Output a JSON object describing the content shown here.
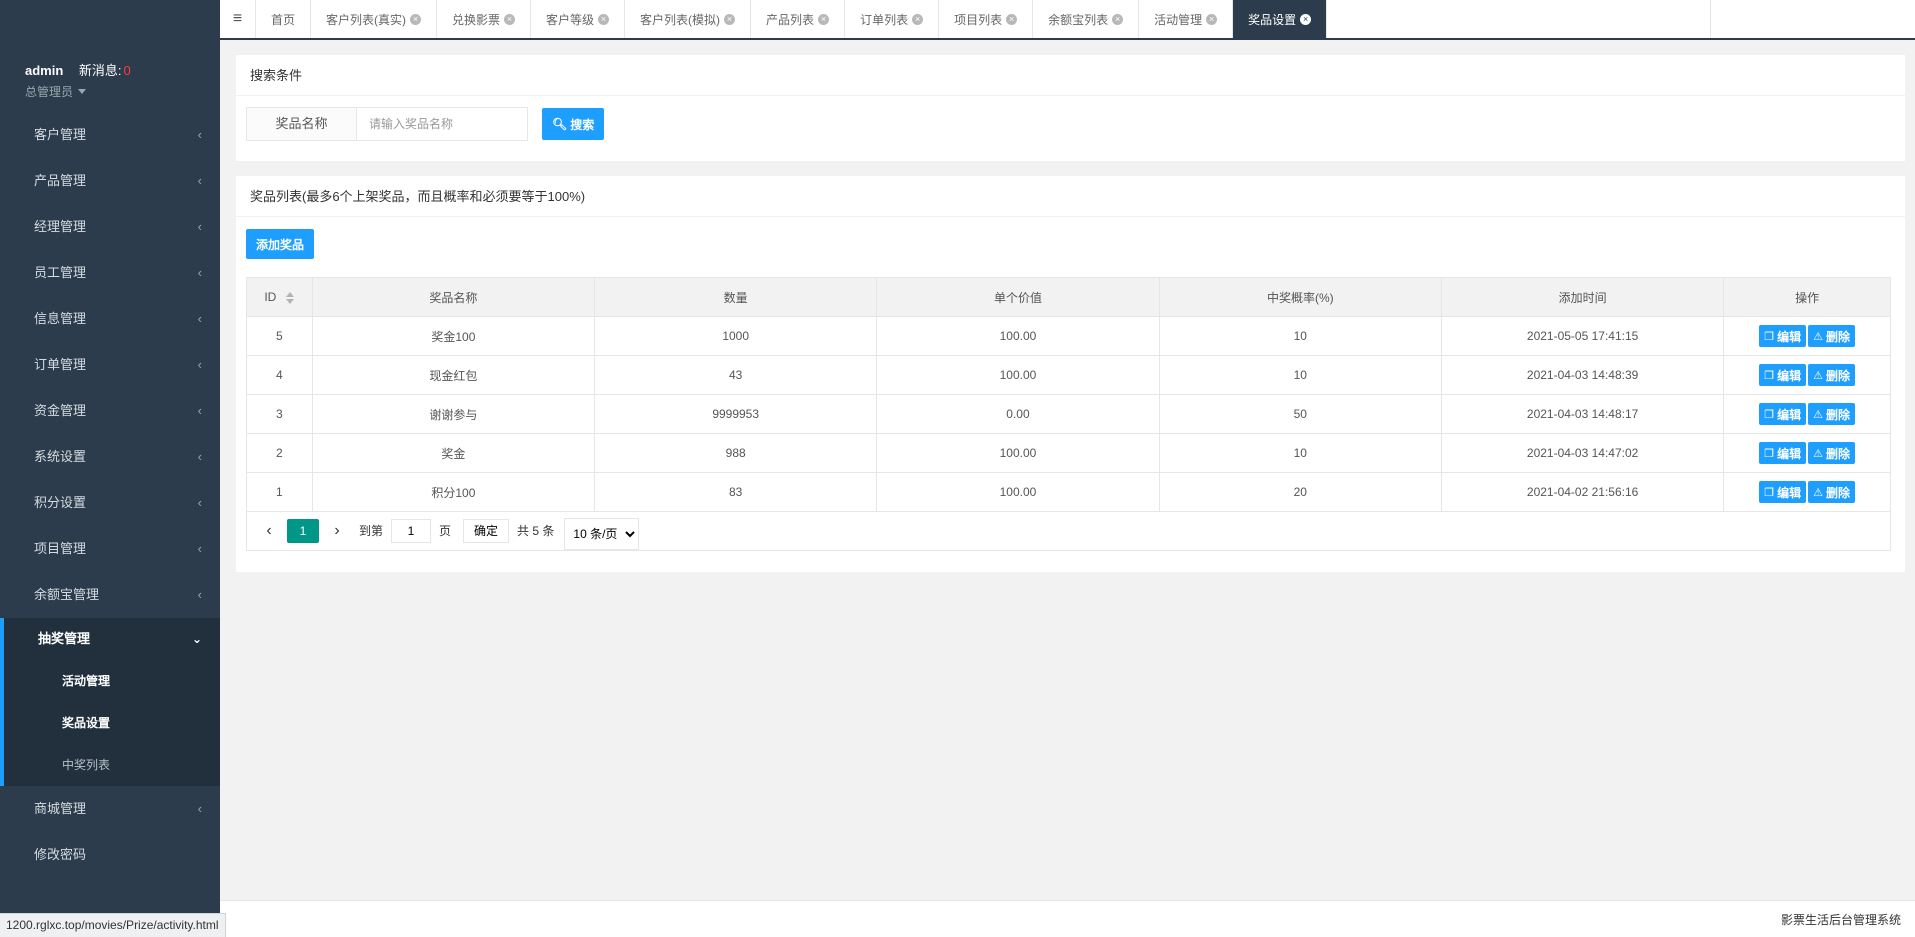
{
  "user": {
    "name": "admin",
    "msg_label": "新消息:",
    "msg_count": "0",
    "role": "总管理员"
  },
  "sidebar": {
    "items": [
      {
        "label": "客户管理"
      },
      {
        "label": "产品管理"
      },
      {
        "label": "经理管理"
      },
      {
        "label": "员工管理"
      },
      {
        "label": "信息管理"
      },
      {
        "label": "订单管理"
      },
      {
        "label": "资金管理"
      },
      {
        "label": "系统设置"
      },
      {
        "label": "积分设置"
      },
      {
        "label": "项目管理"
      },
      {
        "label": "余额宝管理"
      }
    ],
    "open_group": {
      "label": "抽奖管理",
      "children": [
        {
          "label": "活动管理"
        },
        {
          "label": "奖品设置"
        },
        {
          "label": "中奖列表"
        }
      ]
    },
    "after_items": [
      {
        "label": "商城管理"
      },
      {
        "label": "修改密码"
      }
    ],
    "chevron": "‹",
    "chevron_down": "⌄"
  },
  "tabs": [
    {
      "label": "首页"
    },
    {
      "label": "客户列表(真实)"
    },
    {
      "label": "兑换影票"
    },
    {
      "label": "客户等级"
    },
    {
      "label": "客户列表(模拟)"
    },
    {
      "label": "产品列表"
    },
    {
      "label": "订单列表"
    },
    {
      "label": "项目列表"
    },
    {
      "label": "余额宝列表"
    },
    {
      "label": "活动管理"
    },
    {
      "label": "奖品设置"
    }
  ],
  "search": {
    "title": "搜索条件",
    "field_label": "奖品名称",
    "placeholder": "请输入奖品名称",
    "button": "搜索"
  },
  "list": {
    "title": "奖品列表(最多6个上架奖品，而且概率和必须要等于100%)",
    "add_button": "添加奖品",
    "columns": [
      "ID",
      "奖品名称",
      "数量",
      "单个价值",
      "中奖概率(%)",
      "添加时间",
      "操作"
    ],
    "rows": [
      {
        "id": "5",
        "name": "奖金100",
        "qty": "1000",
        "value": "100.00",
        "rate": "10",
        "time": "2021-05-05 17:41:15"
      },
      {
        "id": "4",
        "name": "现金红包",
        "qty": "43",
        "value": "100.00",
        "rate": "10",
        "time": "2021-04-03 14:48:39"
      },
      {
        "id": "3",
        "name": "谢谢参与",
        "qty": "9999953",
        "value": "0.00",
        "rate": "50",
        "time": "2021-04-03 14:48:17"
      },
      {
        "id": "2",
        "name": "奖金",
        "qty": "988",
        "value": "100.00",
        "rate": "10",
        "time": "2021-04-03 14:47:02"
      },
      {
        "id": "1",
        "name": "积分100",
        "qty": "83",
        "value": "100.00",
        "rate": "20",
        "time": "2021-04-02 21:56:16"
      }
    ],
    "edit_label": "编辑",
    "delete_label": "删除"
  },
  "pager": {
    "current": "1",
    "goto_label": "到第",
    "page_input": "1",
    "page_unit": "页",
    "confirm": "确定",
    "total": "共 5 条",
    "per_page": "10 条/页"
  },
  "footer": {
    "text": "影票生活后台管理系统"
  },
  "statusbar": {
    "url": "1200.rglxc.top/movies/Prize/activity.html"
  }
}
